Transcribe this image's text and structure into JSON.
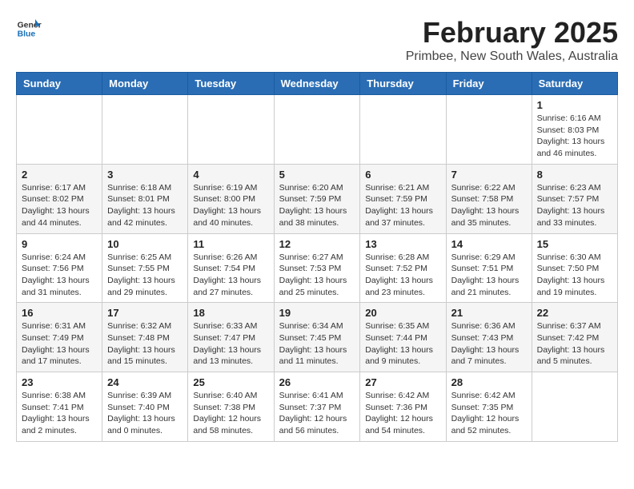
{
  "header": {
    "logo_general": "General",
    "logo_blue": "Blue",
    "month_title": "February 2025",
    "location": "Primbee, New South Wales, Australia"
  },
  "weekdays": [
    "Sunday",
    "Monday",
    "Tuesday",
    "Wednesday",
    "Thursday",
    "Friday",
    "Saturday"
  ],
  "weeks": [
    [
      {
        "day": "",
        "info": ""
      },
      {
        "day": "",
        "info": ""
      },
      {
        "day": "",
        "info": ""
      },
      {
        "day": "",
        "info": ""
      },
      {
        "day": "",
        "info": ""
      },
      {
        "day": "",
        "info": ""
      },
      {
        "day": "1",
        "info": "Sunrise: 6:16 AM\nSunset: 8:03 PM\nDaylight: 13 hours\nand 46 minutes."
      }
    ],
    [
      {
        "day": "2",
        "info": "Sunrise: 6:17 AM\nSunset: 8:02 PM\nDaylight: 13 hours\nand 44 minutes."
      },
      {
        "day": "3",
        "info": "Sunrise: 6:18 AM\nSunset: 8:01 PM\nDaylight: 13 hours\nand 42 minutes."
      },
      {
        "day": "4",
        "info": "Sunrise: 6:19 AM\nSunset: 8:00 PM\nDaylight: 13 hours\nand 40 minutes."
      },
      {
        "day": "5",
        "info": "Sunrise: 6:20 AM\nSunset: 7:59 PM\nDaylight: 13 hours\nand 38 minutes."
      },
      {
        "day": "6",
        "info": "Sunrise: 6:21 AM\nSunset: 7:59 PM\nDaylight: 13 hours\nand 37 minutes."
      },
      {
        "day": "7",
        "info": "Sunrise: 6:22 AM\nSunset: 7:58 PM\nDaylight: 13 hours\nand 35 minutes."
      },
      {
        "day": "8",
        "info": "Sunrise: 6:23 AM\nSunset: 7:57 PM\nDaylight: 13 hours\nand 33 minutes."
      }
    ],
    [
      {
        "day": "9",
        "info": "Sunrise: 6:24 AM\nSunset: 7:56 PM\nDaylight: 13 hours\nand 31 minutes."
      },
      {
        "day": "10",
        "info": "Sunrise: 6:25 AM\nSunset: 7:55 PM\nDaylight: 13 hours\nand 29 minutes."
      },
      {
        "day": "11",
        "info": "Sunrise: 6:26 AM\nSunset: 7:54 PM\nDaylight: 13 hours\nand 27 minutes."
      },
      {
        "day": "12",
        "info": "Sunrise: 6:27 AM\nSunset: 7:53 PM\nDaylight: 13 hours\nand 25 minutes."
      },
      {
        "day": "13",
        "info": "Sunrise: 6:28 AM\nSunset: 7:52 PM\nDaylight: 13 hours\nand 23 minutes."
      },
      {
        "day": "14",
        "info": "Sunrise: 6:29 AM\nSunset: 7:51 PM\nDaylight: 13 hours\nand 21 minutes."
      },
      {
        "day": "15",
        "info": "Sunrise: 6:30 AM\nSunset: 7:50 PM\nDaylight: 13 hours\nand 19 minutes."
      }
    ],
    [
      {
        "day": "16",
        "info": "Sunrise: 6:31 AM\nSunset: 7:49 PM\nDaylight: 13 hours\nand 17 minutes."
      },
      {
        "day": "17",
        "info": "Sunrise: 6:32 AM\nSunset: 7:48 PM\nDaylight: 13 hours\nand 15 minutes."
      },
      {
        "day": "18",
        "info": "Sunrise: 6:33 AM\nSunset: 7:47 PM\nDaylight: 13 hours\nand 13 minutes."
      },
      {
        "day": "19",
        "info": "Sunrise: 6:34 AM\nSunset: 7:45 PM\nDaylight: 13 hours\nand 11 minutes."
      },
      {
        "day": "20",
        "info": "Sunrise: 6:35 AM\nSunset: 7:44 PM\nDaylight: 13 hours\nand 9 minutes."
      },
      {
        "day": "21",
        "info": "Sunrise: 6:36 AM\nSunset: 7:43 PM\nDaylight: 13 hours\nand 7 minutes."
      },
      {
        "day": "22",
        "info": "Sunrise: 6:37 AM\nSunset: 7:42 PM\nDaylight: 13 hours\nand 5 minutes."
      }
    ],
    [
      {
        "day": "23",
        "info": "Sunrise: 6:38 AM\nSunset: 7:41 PM\nDaylight: 13 hours\nand 2 minutes."
      },
      {
        "day": "24",
        "info": "Sunrise: 6:39 AM\nSunset: 7:40 PM\nDaylight: 13 hours\nand 0 minutes."
      },
      {
        "day": "25",
        "info": "Sunrise: 6:40 AM\nSunset: 7:38 PM\nDaylight: 12 hours\nand 58 minutes."
      },
      {
        "day": "26",
        "info": "Sunrise: 6:41 AM\nSunset: 7:37 PM\nDaylight: 12 hours\nand 56 minutes."
      },
      {
        "day": "27",
        "info": "Sunrise: 6:42 AM\nSunset: 7:36 PM\nDaylight: 12 hours\nand 54 minutes."
      },
      {
        "day": "28",
        "info": "Sunrise: 6:42 AM\nSunset: 7:35 PM\nDaylight: 12 hours\nand 52 minutes."
      },
      {
        "day": "",
        "info": ""
      }
    ]
  ]
}
